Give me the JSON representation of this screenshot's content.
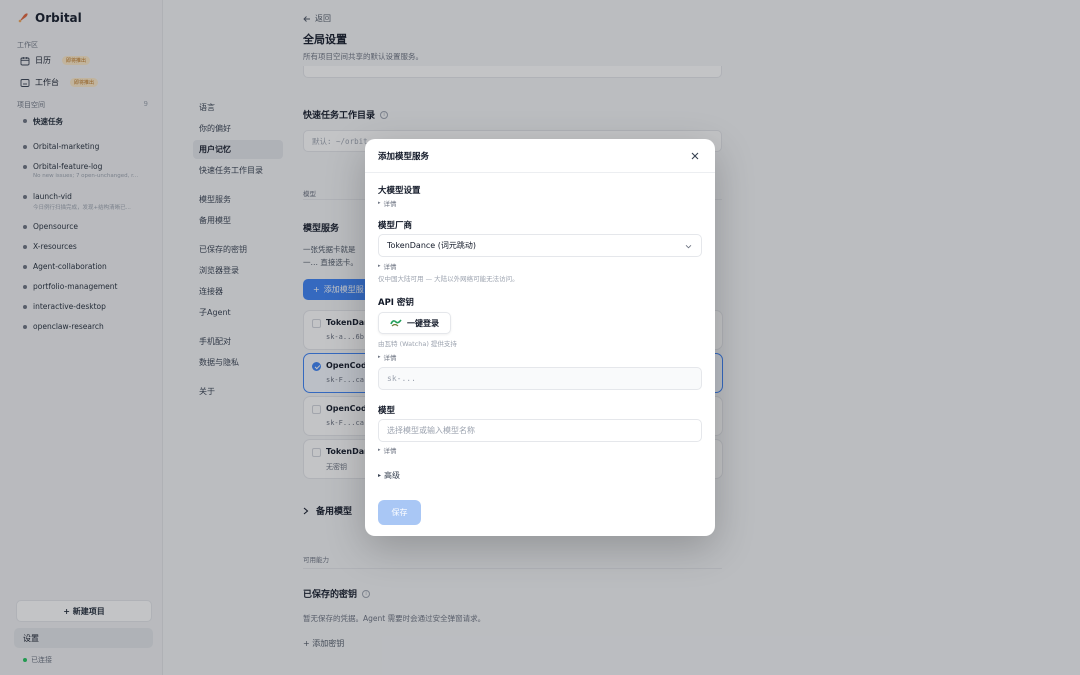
{
  "app": {
    "name": "Orbital"
  },
  "sidebar": {
    "workspace_label": "工作区",
    "workspace_items": [
      {
        "label": "日历",
        "badge": "即将推出",
        "icon": "calendar-icon"
      },
      {
        "label": "工作台",
        "badge": "即将推出",
        "icon": "dashboard-icon"
      }
    ],
    "projects_label": "项目空间",
    "projects_count": "9",
    "projects": [
      {
        "name": "快速任务",
        "sub": ""
      },
      {
        "name": "Orbital-marketing",
        "sub": ""
      },
      {
        "name": "Orbital-feature-log",
        "sub": "No new issues; 7 open-unchanged, r..."
      },
      {
        "name": "launch-vid",
        "sub": "今日例行扫描完成，发现+结构清晰已..."
      },
      {
        "name": "Opensource",
        "sub": ""
      },
      {
        "name": "X-resources",
        "sub": ""
      },
      {
        "name": "Agent-collaboration",
        "sub": ""
      },
      {
        "name": "portfolio-management",
        "sub": ""
      },
      {
        "name": "interactive-desktop",
        "sub": ""
      },
      {
        "name": "openclaw-research",
        "sub": ""
      }
    ],
    "new_project": "+ 新建项目",
    "settings": "设置",
    "status": "已连接"
  },
  "settings_nav": [
    "语言",
    "你的偏好",
    "用户记忆",
    "快速任务工作目录",
    "模型服务",
    "备用模型",
    "已保存的密钥",
    "浏览器登录",
    "连接器",
    "子Agent",
    "手机配对",
    "数据与隐私",
    "关于"
  ],
  "main": {
    "back": "返回",
    "title": "全局设置",
    "description": "所有项目空间共享的默认设置服务。",
    "quick_dir_title": "快速任务工作目录",
    "quick_dir_placeholder": "默认: ~/orbit…",
    "model_section_label": "模型",
    "model_service_title": "模型服务",
    "model_service_desc": "一张凭据卡就是一… 直接选卡。",
    "add_model_btn": "添加模型服",
    "cards": [
      {
        "name": "TokenDan",
        "key": "sk-a...6b"
      },
      {
        "name": "OpenCode",
        "key": "sk-F...ca"
      },
      {
        "name": "OpenCode",
        "key": "sk-F...ca"
      },
      {
        "name": "TokenDan",
        "key": "无密钥"
      }
    ],
    "fallback_title": "备用模型",
    "capability_label": "可用能力",
    "saved_keys_title": "已保存的密钥",
    "saved_keys_desc": "暂无保存的凭据。Agent 需要时会通过安全弹窗请求。",
    "add_key": "+ 添加密钥"
  },
  "modal": {
    "title": "添加模型服务",
    "llm_settings": "大模型设置",
    "detail": "详情",
    "vendor_label": "模型厂商",
    "vendor_value": "TokenDance (词元跳动)",
    "vendor_note": "仅中国大陆可用 — 大陆以外网络可能无法访问。",
    "api_key_label": "API 密钥",
    "login_btn": "一键登录",
    "provider_note": "由瓦特 (Watcha) 提供支持",
    "api_key_placeholder": "sk-...",
    "model_label": "模型",
    "model_placeholder": "选择模型或输入模型名称",
    "advanced": "高级",
    "save": "保存"
  },
  "colors": {
    "accent": "#3b82f6",
    "badge_bg": "#fde9c8",
    "badge_text": "#b86e15"
  }
}
